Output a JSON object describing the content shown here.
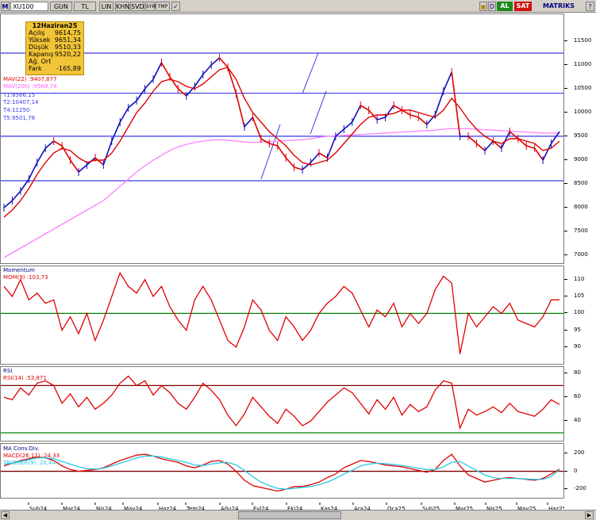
{
  "toolbar": {
    "symbol": "XU100",
    "m_label": "M",
    "buttons": [
      "GUN",
      "TL",
      "LIN",
      "KHN",
      "SVD",
      "SYM",
      "TMP"
    ],
    "al": "AL",
    "sat": "SAT",
    "matriks": "MATRIKS",
    "d_label": "D",
    "q_label": "?"
  },
  "ohlc": {
    "date": "12Haziran25",
    "rows": [
      {
        "k": "Açılış",
        "v": "9614,75"
      },
      {
        "k": "Yüksek",
        "v": "9651,34"
      },
      {
        "k": "Düşük",
        "v": "9510,33"
      },
      {
        "k": "Kapanış",
        "v": "9520,22"
      },
      {
        "k": "Ağ. Ort",
        "v": ""
      },
      {
        "k": "Fark",
        "v": "-165,89"
      }
    ]
  },
  "price_labels": {
    "mav22": "MAV(22)",
    "mav22_val": ":9407,877",
    "mav200": "MAV(200)",
    "mav200_val": ":9568,74",
    "t1": "T1:8566,15",
    "t2": "T2:10407,14",
    "t4": "T4:11250",
    "t5": "T5:9501,78"
  },
  "mom_labels": {
    "title": "Momentum",
    "name": "MOM(9)",
    "val": ":103,73"
  },
  "rsi_labels": {
    "title": "RSI",
    "name": "RSI(14)",
    "val": ":53,871"
  },
  "macd_labels": {
    "title": "MA Conv.Div.",
    "name": "MACD(26,12)",
    "val": ":24,33",
    "trigger": "TRIGGER(9)",
    "tval": ":20,44"
  },
  "colors": {
    "price": "#1010c0",
    "price_down": "#e00000",
    "mav22": "#e00000",
    "mav200": "#ff80ff",
    "hline": "#3a3ae8",
    "mom_line": "#e00000",
    "mom_ref": "#008000",
    "rsi_ref": "#800000",
    "rsi_ref2": "#008000",
    "macd": "#e00000",
    "trigger": "#29c8e8",
    "zero": "#800000"
  },
  "chart_data": [
    {
      "type": "line",
      "name": "XU100 fiyat",
      "ylim": [
        6900,
        12000
      ],
      "yticks": [
        7000,
        7500,
        8000,
        8500,
        9000,
        9500,
        10000,
        10500,
        11000,
        11500
      ],
      "hlines": [
        8566.15,
        9501.78,
        10407.14,
        11250
      ],
      "series": [
        {
          "name": "XU100",
          "values": [
            8000,
            8150,
            8350,
            8600,
            8950,
            9250,
            9400,
            9300,
            9000,
            8750,
            8900,
            9050,
            8900,
            9400,
            9800,
            10100,
            10250,
            10500,
            10700,
            11050,
            10750,
            10500,
            10350,
            10550,
            10800,
            11000,
            11150,
            10950,
            10400,
            9700,
            9900,
            9450,
            9350,
            9300,
            9050,
            8850,
            8800,
            8950,
            9150,
            9050,
            9500,
            9650,
            9800,
            10150,
            10050,
            9850,
            9900,
            10150,
            10050,
            9950,
            9900,
            9750,
            9950,
            10450,
            10850,
            9500,
            9500,
            9350,
            9200,
            9400,
            9250,
            9600,
            9450,
            9300,
            9250,
            9000,
            9350,
            9600
          ]
        },
        {
          "name": "MAV(22)",
          "values": [
            7800,
            7950,
            8150,
            8400,
            8700,
            8950,
            9150,
            9250,
            9200,
            9050,
            8950,
            9000,
            9000,
            9150,
            9400,
            9700,
            10000,
            10200,
            10450,
            10650,
            10700,
            10650,
            10550,
            10500,
            10600,
            10750,
            10900,
            10950,
            10700,
            10300,
            10000,
            9800,
            9600,
            9450,
            9300,
            9100,
            8950,
            8900,
            8950,
            9000,
            9150,
            9350,
            9550,
            9750,
            9900,
            9950,
            9950,
            9980,
            10050,
            10050,
            10000,
            9950,
            9900,
            10050,
            10300,
            10100,
            9850,
            9650,
            9500,
            9400,
            9350,
            9450,
            9450,
            9400,
            9350,
            9200,
            9250,
            9400
          ]
        },
        {
          "name": "MAV(200)",
          "values": [
            6950,
            7050,
            7150,
            7250,
            7350,
            7450,
            7550,
            7650,
            7750,
            7850,
            7950,
            8050,
            8150,
            8300,
            8450,
            8600,
            8750,
            8880,
            9000,
            9100,
            9200,
            9280,
            9330,
            9370,
            9400,
            9420,
            9430,
            9420,
            9400,
            9380,
            9370,
            9380,
            9390,
            9400,
            9410,
            9420,
            9430,
            9450,
            9480,
            9500,
            9510,
            9520,
            9530,
            9540,
            9550,
            9560,
            9570,
            9580,
            9590,
            9600,
            9610,
            9620,
            9630,
            9650,
            9660,
            9660,
            9660,
            9650,
            9640,
            9630,
            9620,
            9610,
            9600,
            9590,
            9580,
            9570,
            9568,
            9568
          ]
        }
      ]
    },
    {
      "type": "line",
      "name": "Momentum",
      "ylim": [
        86,
        113
      ],
      "yticks": [
        90,
        95,
        100,
        105,
        110
      ],
      "ref": 100,
      "series": [
        {
          "name": "MOM(9)",
          "values": [
            108,
            105,
            110,
            104,
            106,
            103,
            104,
            95,
            99,
            94,
            100,
            92,
            98,
            105,
            112,
            108,
            106,
            110,
            105,
            108,
            102,
            98,
            95,
            104,
            108,
            104,
            98,
            92,
            90,
            96,
            104,
            101,
            95,
            92,
            99,
            96,
            92,
            95,
            100,
            103,
            105,
            108,
            106,
            101,
            96,
            101,
            99,
            103,
            96,
            100,
            97,
            100,
            107,
            111,
            109,
            88,
            100,
            96,
            99,
            102,
            100,
            103,
            98,
            97,
            96,
            99,
            104,
            104
          ]
        }
      ]
    },
    {
      "type": "line",
      "name": "RSI",
      "ylim": [
        26,
        83
      ],
      "yticks": [
        40,
        60,
        80
      ],
      "ref": [
        70,
        30
      ],
      "series": [
        {
          "name": "RSI(14)",
          "values": [
            60,
            58,
            68,
            62,
            72,
            74,
            70,
            55,
            63,
            52,
            60,
            50,
            55,
            62,
            72,
            78,
            70,
            74,
            62,
            70,
            64,
            55,
            50,
            60,
            72,
            66,
            58,
            45,
            36,
            46,
            60,
            52,
            44,
            38,
            50,
            44,
            36,
            40,
            48,
            56,
            62,
            68,
            64,
            55,
            46,
            58,
            50,
            60,
            45,
            54,
            48,
            52,
            66,
            74,
            72,
            34,
            50,
            45,
            48,
            52,
            47,
            55,
            48,
            46,
            44,
            50,
            58,
            54
          ]
        }
      ]
    },
    {
      "type": "line",
      "name": "MA Conv.Div.",
      "ylim": [
        -260,
        270
      ],
      "yticks": [
        -200,
        0,
        200
      ],
      "ref": 0,
      "series": [
        {
          "name": "MACD(26,12)",
          "values": [
            60,
            90,
            120,
            140,
            160,
            150,
            120,
            60,
            20,
            0,
            10,
            20,
            40,
            80,
            120,
            150,
            180,
            190,
            170,
            140,
            120,
            100,
            60,
            40,
            70,
            110,
            120,
            80,
            0,
            -100,
            -160,
            -180,
            -200,
            -220,
            -200,
            -170,
            -170,
            -150,
            -120,
            -70,
            -30,
            40,
            80,
            120,
            110,
            90,
            70,
            60,
            50,
            30,
            10,
            -10,
            20,
            120,
            190,
            60,
            -40,
            -80,
            -120,
            -100,
            -80,
            -70,
            -80,
            -90,
            -100,
            -80,
            -30,
            24
          ]
        },
        {
          "name": "TRIGGER(9)",
          "values": [
            80,
            90,
            110,
            130,
            150,
            150,
            140,
            110,
            80,
            50,
            30,
            25,
            35,
            60,
            90,
            120,
            150,
            170,
            170,
            160,
            140,
            120,
            100,
            70,
            65,
            80,
            95,
            100,
            70,
            10,
            -60,
            -120,
            -160,
            -190,
            -200,
            -190,
            -180,
            -170,
            -150,
            -120,
            -80,
            -30,
            10,
            60,
            80,
            90,
            85,
            75,
            65,
            50,
            35,
            20,
            20,
            50,
            100,
            110,
            60,
            10,
            -40,
            -70,
            -80,
            -80,
            -80,
            -85,
            -90,
            -90,
            -60,
            20
          ]
        }
      ]
    }
  ],
  "date_labels": [
    "Şub24",
    "Mar24",
    "Nis24",
    "May24",
    "Haz24",
    "Tem24",
    "Ağu24",
    "Eyl24",
    "Eki24",
    "Kas24",
    "Ara24",
    "Oca25",
    "Şub25",
    "Mar25",
    "Nis25",
    "May25",
    "Haz25"
  ]
}
